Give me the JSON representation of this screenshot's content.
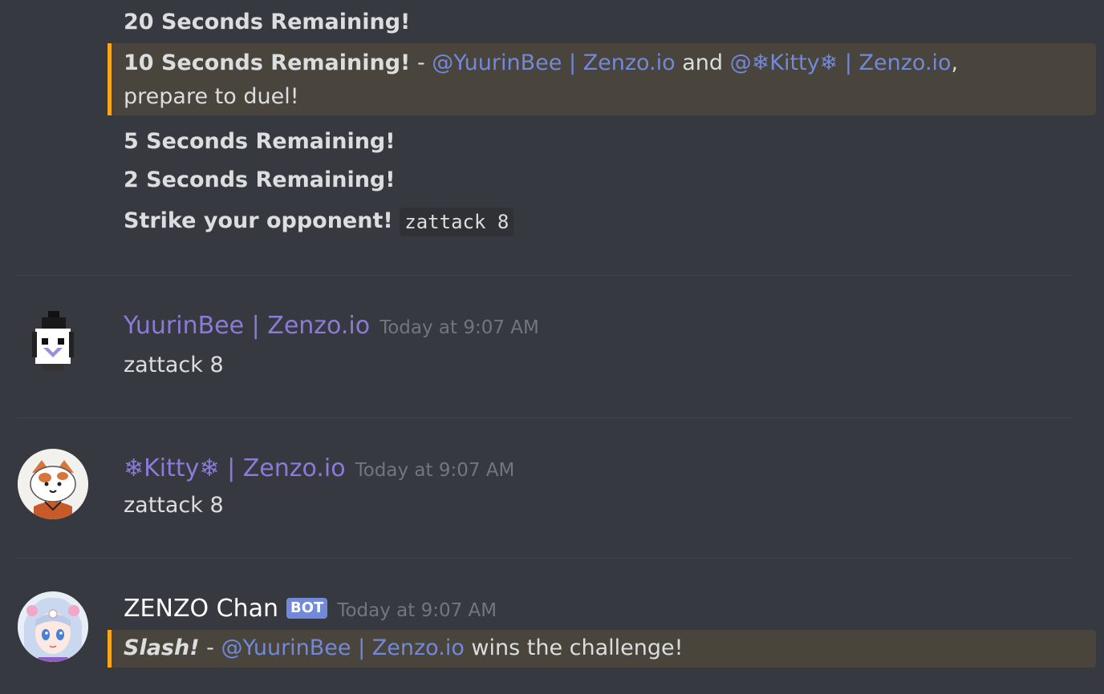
{
  "system_messages": {
    "line1": "20 Seconds Remaining!",
    "line2": {
      "bold": "10 Seconds Remaining!",
      "sep": " - ",
      "mention1": "@YuurinBee | Zenzo.io",
      "and": " and ",
      "mention2": "@❄Kitty❄ | Zenzo.io",
      "comma": ",",
      "rest": "prepare to duel!"
    },
    "line3": "5 Seconds Remaining!",
    "line4": "2 Seconds Remaining!",
    "line5": {
      "bold": "Strike your opponent!",
      "code": "zattack 8"
    }
  },
  "messages": [
    {
      "username": "YuurinBee | Zenzo.io",
      "username_color": "#8b7ad8",
      "timestamp": "Today at 9:07 AM",
      "text": "zattack 8"
    },
    {
      "username": "❄Kitty❄ | Zenzo.io",
      "username_color": "#8b7ad8",
      "timestamp": "Today at 9:07 AM",
      "text": "zattack 8"
    },
    {
      "username": "ZENZO Chan",
      "username_color": "#ffffff",
      "badge": "BOT",
      "timestamp": "Today at 9:07 AM",
      "italic": "Slash!",
      "sep": " - ",
      "mention": "@YuurinBee | Zenzo.io",
      "rest": " wins the challenge!"
    }
  ],
  "colors": {
    "background": "#36393f",
    "mention": "#7289da",
    "highlight_bg": "#49443c",
    "highlight_border": "#faa61a"
  }
}
